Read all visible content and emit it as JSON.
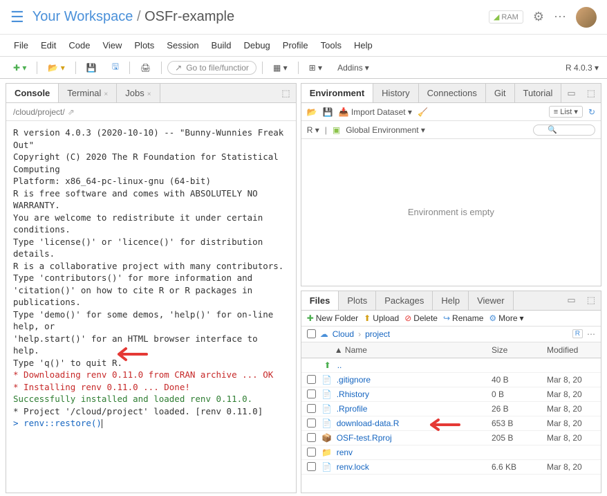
{
  "header": {
    "workspace": "Your Workspace",
    "project": "OSFr-example",
    "ram": "RAM"
  },
  "menubar": [
    "File",
    "Edit",
    "Code",
    "View",
    "Plots",
    "Session",
    "Build",
    "Debug",
    "Profile",
    "Tools",
    "Help"
  ],
  "toolbar": {
    "goto": "Go to file/functior",
    "addins": "Addins",
    "rversion": "R 4.0.3"
  },
  "left": {
    "tabs": [
      "Console",
      "Terminal",
      "Jobs"
    ],
    "active": 0,
    "path": "/cloud/project/",
    "console": [
      {
        "t": "",
        "c": ""
      },
      {
        "t": "R version 4.0.3 (2020-10-10) -- \"Bunny-Wunnies Freak Out\"",
        "c": ""
      },
      {
        "t": "Copyright (C) 2020 The R Foundation for Statistical Computing",
        "c": ""
      },
      {
        "t": "Platform: x86_64-pc-linux-gnu (64-bit)",
        "c": ""
      },
      {
        "t": "",
        "c": ""
      },
      {
        "t": "R is free software and comes with ABSOLUTELY NO WARRANTY.",
        "c": ""
      },
      {
        "t": "You are welcome to redistribute it under certain conditions.",
        "c": ""
      },
      {
        "t": "Type 'license()' or 'licence()' for distribution details.",
        "c": ""
      },
      {
        "t": "",
        "c": ""
      },
      {
        "t": "R is a collaborative project with many contributors.",
        "c": ""
      },
      {
        "t": "Type 'contributors()' for more information and",
        "c": ""
      },
      {
        "t": "'citation()' on how to cite R or R packages in publications.",
        "c": ""
      },
      {
        "t": "",
        "c": ""
      },
      {
        "t": "Type 'demo()' for some demos, 'help()' for on-line help, or",
        "c": ""
      },
      {
        "t": "'help.start()' for an HTML browser interface to help.",
        "c": ""
      },
      {
        "t": "Type 'q()' to quit R.",
        "c": ""
      },
      {
        "t": "",
        "c": ""
      },
      {
        "t": "* Downloading renv 0.11.0 from CRAN archive ... OK",
        "c": "err"
      },
      {
        "t": "* Installing renv 0.11.0 ... Done!",
        "c": "err"
      },
      {
        "t": "Successfully installed and loaded renv 0.11.0.",
        "c": "ok"
      },
      {
        "t": "* Project '/cloud/project' loaded. [renv 0.11.0]",
        "c": ""
      }
    ],
    "prompt": "> ",
    "input": "renv::restore()"
  },
  "env": {
    "tabs": [
      "Environment",
      "History",
      "Connections",
      "Git",
      "Tutorial"
    ],
    "active": 0,
    "import": "Import Dataset",
    "list": "List",
    "scope_r": "R",
    "scope": "Global Environment",
    "empty": "Environment is empty"
  },
  "files": {
    "tabs": [
      "Files",
      "Plots",
      "Packages",
      "Help",
      "Viewer"
    ],
    "active": 0,
    "toolbar": {
      "newfolder": "New Folder",
      "upload": "Upload",
      "delete": "Delete",
      "rename": "Rename",
      "more": "More"
    },
    "path": {
      "cloud": "Cloud",
      "project": "project"
    },
    "headers": {
      "name": "Name",
      "size": "Size",
      "modified": "Modified"
    },
    "up": "..",
    "rows": [
      {
        "icon": "📄",
        "iconcolor": "#ff6b35",
        "name": ".gitignore",
        "size": "40 B",
        "mod": "Mar 8, 20"
      },
      {
        "icon": "📄",
        "iconcolor": "#888",
        "name": ".Rhistory",
        "size": "0 B",
        "mod": "Mar 8, 20"
      },
      {
        "icon": "📄",
        "iconcolor": "#888",
        "name": ".Rprofile",
        "size": "26 B",
        "mod": "Mar 8, 20"
      },
      {
        "icon": "📄",
        "iconcolor": "#4a90d9",
        "name": "download-data.R",
        "size": "653 B",
        "mod": "Mar 8, 20"
      },
      {
        "icon": "📦",
        "iconcolor": "#4a90d9",
        "name": "OSF-test.Rproj",
        "size": "205 B",
        "mod": "Mar 8, 20"
      },
      {
        "icon": "📁",
        "iconcolor": "#f4c430",
        "name": "renv",
        "size": "",
        "mod": ""
      },
      {
        "icon": "📄",
        "iconcolor": "#ccc",
        "name": "renv.lock",
        "size": "6.6 KB",
        "mod": "Mar 8, 20"
      }
    ]
  }
}
